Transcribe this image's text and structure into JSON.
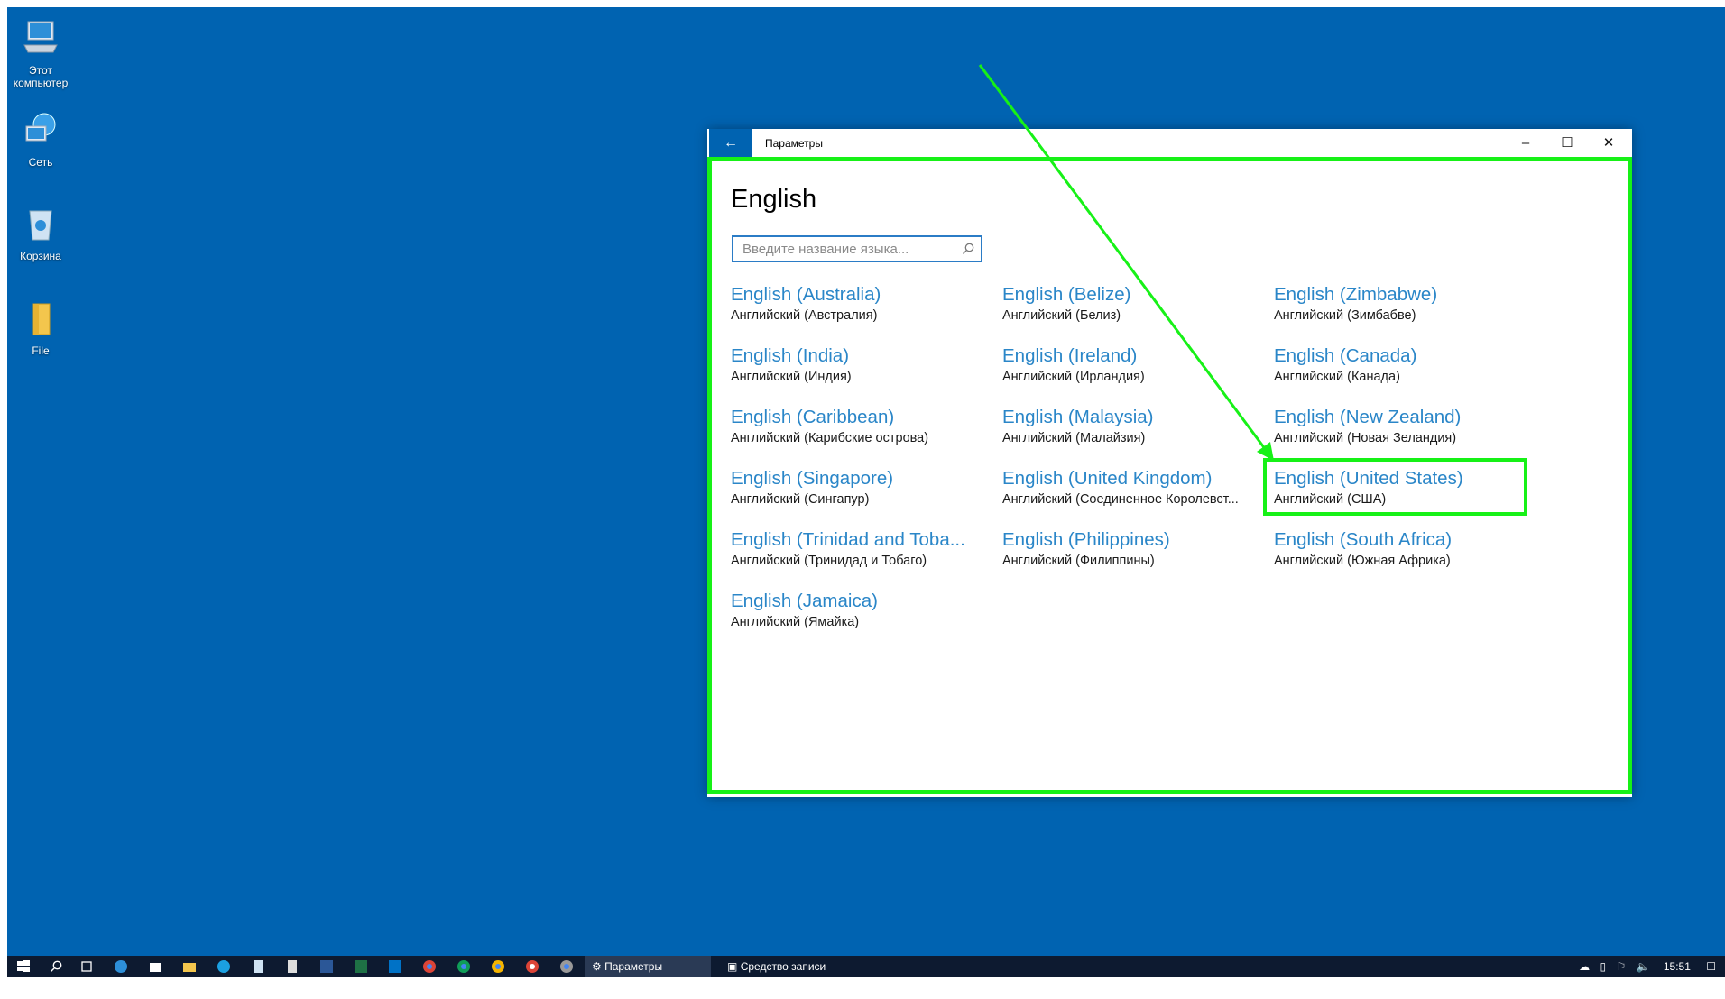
{
  "desktop": {
    "icons": [
      {
        "label": "Этот\nкомпьютер",
        "icon": "computer-icon"
      },
      {
        "label": "Сеть",
        "icon": "network-icon"
      },
      {
        "label": "Корзина",
        "icon": "recycle-bin-icon"
      },
      {
        "label": "File",
        "icon": "folder-icon"
      }
    ]
  },
  "window": {
    "title": "Параметры",
    "back_icon": "←",
    "minimize_icon": "–",
    "maximize_icon": "☐",
    "close_icon": "✕"
  },
  "page": {
    "heading": "English",
    "search_placeholder": "Введите название языка...",
    "languages": [
      {
        "name": "English (Australia)",
        "local": "Английский (Австралия)"
      },
      {
        "name": "English (Belize)",
        "local": "Английский (Белиз)"
      },
      {
        "name": "English (Zimbabwe)",
        "local": "Английский (Зимбабве)"
      },
      {
        "name": "English (India)",
        "local": "Английский (Индия)"
      },
      {
        "name": "English (Ireland)",
        "local": "Английский (Ирландия)"
      },
      {
        "name": "English (Canada)",
        "local": "Английский (Канада)"
      },
      {
        "name": "English (Caribbean)",
        "local": "Английский (Карибские острова)"
      },
      {
        "name": "English (Malaysia)",
        "local": "Английский (Малайзия)"
      },
      {
        "name": "English (New Zealand)",
        "local": "Английский (Новая Зеландия)"
      },
      {
        "name": "English (Singapore)",
        "local": "Английский (Сингапур)"
      },
      {
        "name": "English (United Kingdom)",
        "local": "Английский (Соединенное Королевст..."
      },
      {
        "name": "English (United States)",
        "local": "Английский (США)"
      },
      {
        "name": "English (Trinidad and Toba...",
        "local": "Английский (Тринидад и Тобаго)"
      },
      {
        "name": "English (Philippines)",
        "local": "Английский (Филиппины)"
      },
      {
        "name": "English (South Africa)",
        "local": "Английский (Южная Африка)"
      },
      {
        "name": "English (Jamaica)",
        "local": "Английский (Ямайка)"
      }
    ]
  },
  "taskbar": {
    "app_settings": "Параметры",
    "app_recorder": "Средство записи дей...",
    "clock": "15:51"
  },
  "colors": {
    "desktop": "#0063b1",
    "link": "#2a86c8",
    "highlight": "#17f117"
  }
}
